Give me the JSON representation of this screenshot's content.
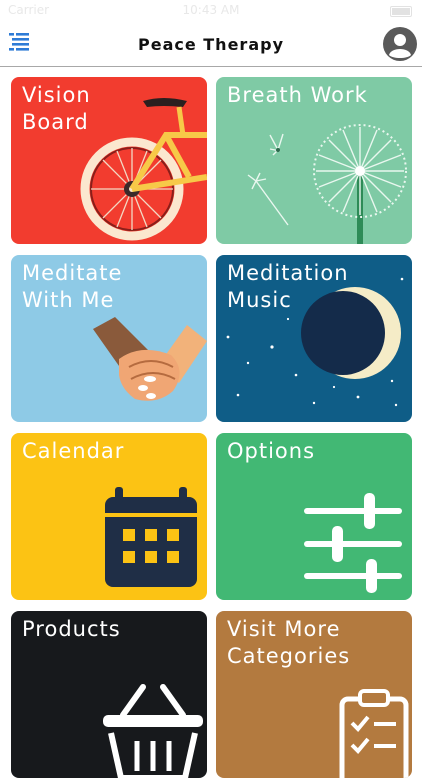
{
  "status_bar": {
    "carrier": "Carrier",
    "time": "10:43 AM"
  },
  "header": {
    "title": "Peace Therapy",
    "menu_icon": "hamburger-menu-icon",
    "profile_icon": "user-avatar-icon"
  },
  "tiles": [
    {
      "label": "Vision\nBoard",
      "color": "#f23c2f",
      "icon": "bicycle-icon"
    },
    {
      "label": "Breath Work",
      "color": "#7fcaa5",
      "icon": "dandelion-icon"
    },
    {
      "label": "Meditate\nWith Me",
      "color": "#8ecae6",
      "icon": "holding-hands-icon"
    },
    {
      "label": "Meditation\nMusic",
      "color": "#0f5d87",
      "icon": "crescent-moon-icon"
    },
    {
      "label": "Calendar",
      "color": "#fcc314",
      "icon": "calendar-icon"
    },
    {
      "label": "Options",
      "color": "#42b874",
      "icon": "sliders-icon"
    },
    {
      "label": "Products",
      "color": "#17191c",
      "icon": "shopping-basket-icon"
    },
    {
      "label": "Visit More\nCategories",
      "color": "#b37a3f",
      "icon": "checklist-clipboard-icon"
    }
  ]
}
